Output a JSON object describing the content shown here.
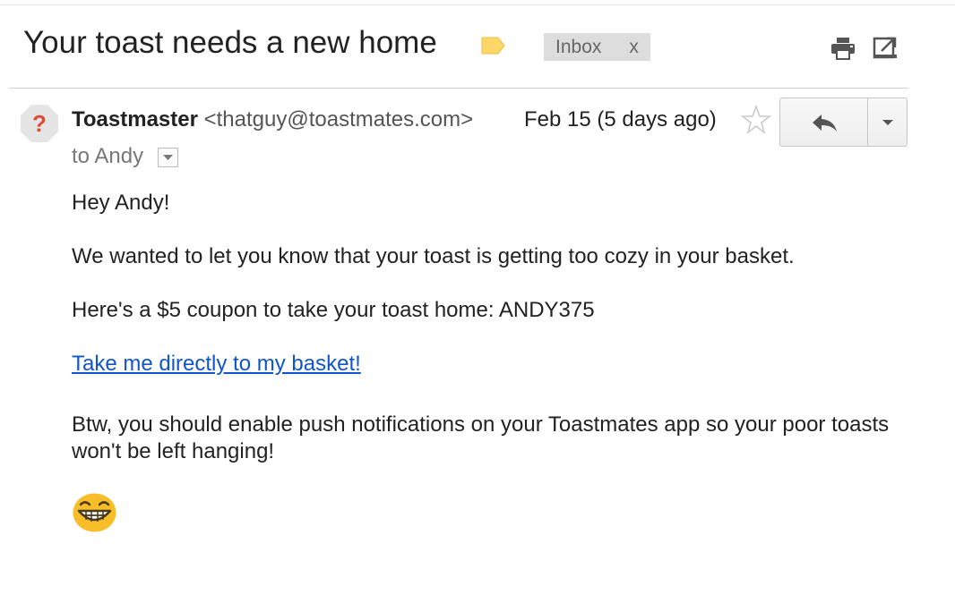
{
  "email": {
    "subject": "Your toast needs a new home",
    "label": "Inbox",
    "label_remove": "x",
    "sender_name": "Toastmaster",
    "sender_email": "<thatguy@toastmates.com>",
    "date": "Feb 15 (5 days ago)",
    "to": "to Andy",
    "body": {
      "greeting": "Hey Andy!",
      "p1": "We wanted to let you know that your toast is getting too cozy in your basket.",
      "p2": "Here's a $5 coupon to take your toast home: ANDY375",
      "link": "Take me directly to my basket!",
      "p3": "Btw, you should enable push notifications on your Toastmates app so your poor toasts won't be left hanging!"
    }
  },
  "icons": {
    "label_tag": "label-tag-icon",
    "print": "print-icon",
    "new_window": "open-in-new-window-icon",
    "avatar": "unknown-sender-avatar",
    "star": "star-icon",
    "reply": "reply-icon",
    "more": "chevron-down-icon",
    "emoji": "grinning-emoji"
  },
  "colors": {
    "link": "#1155cc",
    "label_tag": "#fcd768",
    "chip_bg": "#dddddd",
    "avatar_mark": "#dd4b39"
  }
}
